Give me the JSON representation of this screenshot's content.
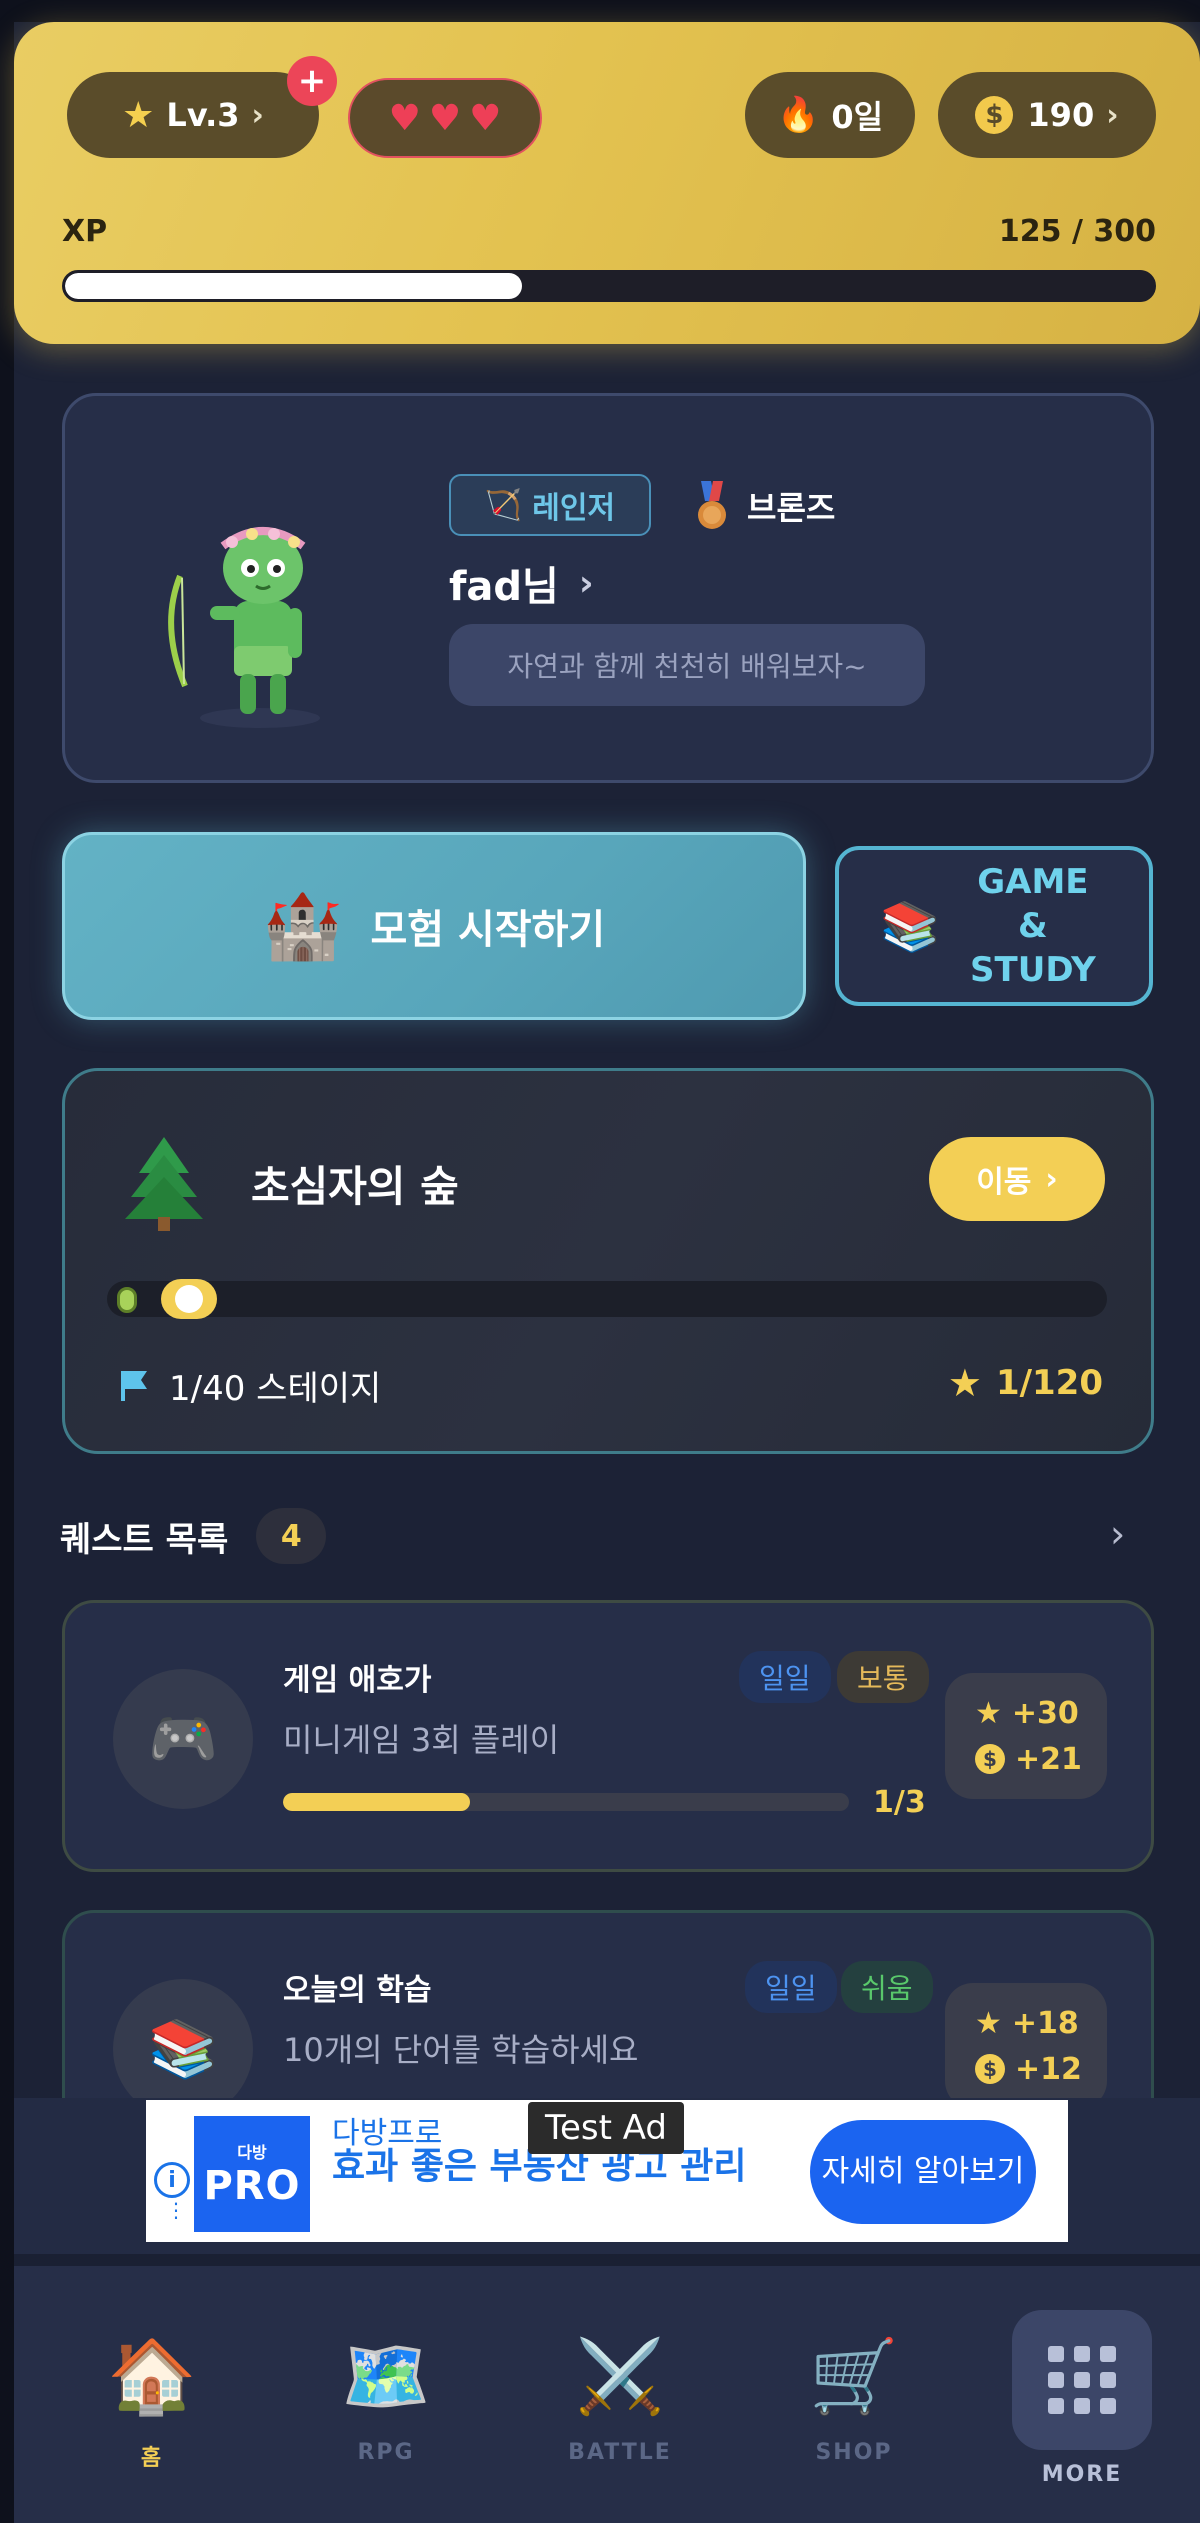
{
  "header": {
    "level_label": "Lv.3",
    "level_plus": "+",
    "hearts": [
      "♥",
      "♥",
      "♥"
    ],
    "streak_label": "0일",
    "coins_label": "190",
    "xp_label": "XP",
    "xp_value": "125 / 300",
    "xp_progress": 0.42
  },
  "profile": {
    "class_name": "레인저",
    "rank_name": "브론즈",
    "username": "fad님",
    "motto": "자연과 함께 천천히 배워보자~"
  },
  "actions": {
    "adventure_label": "모험 시작하기",
    "study_label_line1": "GAME &",
    "study_label_line2": "STUDY"
  },
  "world": {
    "title": "초심자의 숲",
    "go_label": "이동",
    "stage_label": "1/40 스테이지",
    "stars_label": "1/120"
  },
  "quests": {
    "heading": "퀘스트 목록",
    "count": "4",
    "items": [
      {
        "title": "게임 애호가",
        "description": "미니게임 3회 플레이",
        "tag_period": "일일",
        "tag_difficulty": "보통",
        "progress_label": "1/3",
        "progress": 0.33,
        "reward_xp": "+30",
        "reward_coins": "+21",
        "icon": "gamepad-icon"
      },
      {
        "title": "오늘의 학습",
        "description": "10개의 단어를 학습하세요",
        "tag_period": "일일",
        "tag_difficulty": "쉬움",
        "reward_xp": "+18",
        "reward_coins": "+12",
        "icon": "books-icon"
      }
    ]
  },
  "ad": {
    "test_label": "Test Ad",
    "logo_small": "다방",
    "logo_big": "PRO",
    "brand": "다방프로",
    "headline": "효과 좋은 부동산 광고 관리",
    "cta": "자세히 알아보기"
  },
  "tabs": [
    {
      "label": "홈",
      "icon": "house-icon"
    },
    {
      "label": "RPG",
      "icon": "map-icon"
    },
    {
      "label": "BATTLE",
      "icon": "crossed-swords-icon"
    },
    {
      "label": "SHOP",
      "icon": "cart-icon"
    },
    {
      "label": "MORE",
      "icon": "grid-icon"
    }
  ],
  "colors": {
    "accent": "#f3cf55",
    "background": "#1c2236",
    "card": "#262e48",
    "teal": "#58a6bb"
  }
}
